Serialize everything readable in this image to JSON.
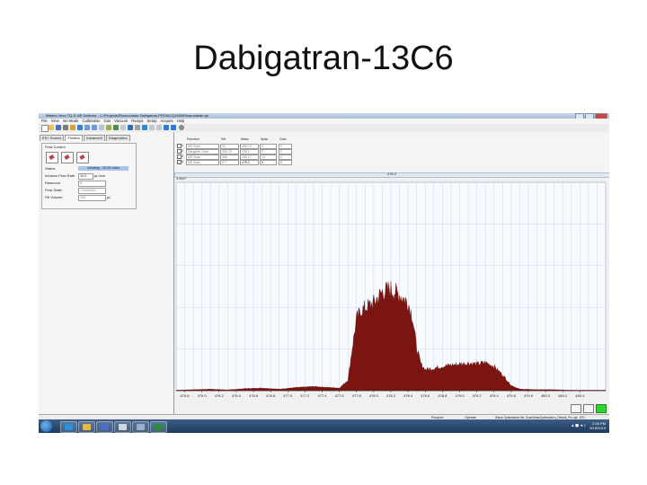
{
  "slide": {
    "title": "Dabigatran-13C6"
  },
  "window": {
    "title": "Waters Xevo TQ-S MS Detector - C:\\Projects\\Rivaroxaban Dabigatran.PRO\\ACQUDB\\Rivaroxaban.ipr"
  },
  "menu": [
    "File",
    "View",
    "Ion-Mode",
    "Calibration",
    "Gas",
    "Vacuum",
    "Ramps",
    "Setup",
    "Acquire",
    "Help"
  ],
  "left_panel": {
    "tabs": [
      "ES+ Source",
      "Fluidics",
      "Advanced",
      "Diagnostics"
    ],
    "active_tab": "Fluidics",
    "group_title": "Flow Control",
    "fields": [
      {
        "label": "Status",
        "value": "Infusing - 10.00 mins"
      },
      {
        "label": "Infusion Flow Rate",
        "value": "10.0",
        "unit": "µL/min"
      },
      {
        "label": "Reservoir",
        "value": "B"
      },
      {
        "label": "Flow State",
        "value": "Combined"
      },
      {
        "label": "Fill Volume",
        "value": "250",
        "unit": "µL"
      }
    ]
  },
  "functions": {
    "headers": [
      "Function",
      "Set",
      "Mass",
      "Span",
      "Gain"
    ],
    "rows": [
      {
        "num": "1",
        "type": "MS Scan",
        "set": "90",
        "mass": "359.70",
        "span": "3",
        "gain": "2"
      },
      {
        "num": "2",
        "type": "Daughter Scan",
        "set": "300.70",
        "mass": "135.1",
        "span": "5",
        "gain": "2"
      },
      {
        "num": "3",
        "type": "MS Scan",
        "set": "360",
        "mass": "295.17",
        "span": "10",
        "gain": "2"
      },
      {
        "num": "4",
        "type": "MS Scan",
        "set": "577",
        "mass": "478.2",
        "span": "5",
        "gain": "2"
      }
    ]
  },
  "chart_header": {
    "center_label": "478.2",
    "scale_label": "3.90e7"
  },
  "chart_data": {
    "type": "area",
    "xlabel": "",
    "ylabel": "",
    "xlim": [
      475.7,
      480.7
    ],
    "ticks": [
      "475.8",
      "476.0",
      "476.2",
      "476.4",
      "476.6",
      "476.8",
      "477.0",
      "477.2",
      "477.4",
      "477.6",
      "477.8",
      "478.0",
      "478.2",
      "478.4",
      "478.6",
      "478.8",
      "479.0",
      "479.2",
      "479.4",
      "479.6",
      "479.8",
      "480.0",
      "480.2",
      "480.4"
    ],
    "ylim": [
      0,
      39000000.0
    ],
    "grid": true,
    "color": "#7b1512",
    "series": [
      {
        "x": [
          475.7,
          475.9,
          476.1,
          476.3,
          476.5,
          476.7,
          476.9,
          477.1,
          477.3,
          477.5,
          477.6,
          477.7,
          477.75,
          477.8,
          477.85,
          477.9,
          478.0,
          478.1,
          478.2,
          478.3,
          478.4,
          478.45,
          478.5,
          478.55,
          478.6,
          478.7,
          478.8,
          478.9,
          479.0,
          479.1,
          479.2,
          479.3,
          479.4,
          479.5,
          479.6,
          479.7,
          479.9,
          480.1,
          480.3,
          480.5,
          480.7
        ],
        "values": [
          100000.0,
          200000.0,
          300000.0,
          150000.0,
          400000.0,
          500000.0,
          300000.0,
          600000.0,
          800000.0,
          600000.0,
          500000.0,
          2000000.0,
          8000000.0,
          13500000.0,
          15000000.0,
          15500000.0,
          16500000.0,
          18500000.0,
          19000000.0,
          18000000.0,
          16500000.0,
          14000000.0,
          8000000.0,
          5000000.0,
          4000000.0,
          4200000.0,
          4600000.0,
          4800000.0,
          5000000.0,
          5200000.0,
          5000000.0,
          5300000.0,
          4600000.0,
          3000000.0,
          1000000.0,
          300000.0,
          200000.0,
          200000.0,
          100000.0,
          100000.0,
          100000.0
        ]
      }
    ]
  },
  "status_bar": {
    "state": "Pumped",
    "mode": "Operate",
    "file": "IMaze Optimization file: Scan\\MassOptimization_Default_Pro.opt - ES+"
  },
  "taskbar": {
    "time": "2:26 PM",
    "date": "9/18/2019"
  },
  "colors": {
    "chart_fill": "#7b1512",
    "chart_bg": "#f7fbff",
    "grid": "#c9d7ea",
    "titlebar": "#b7c9df"
  }
}
